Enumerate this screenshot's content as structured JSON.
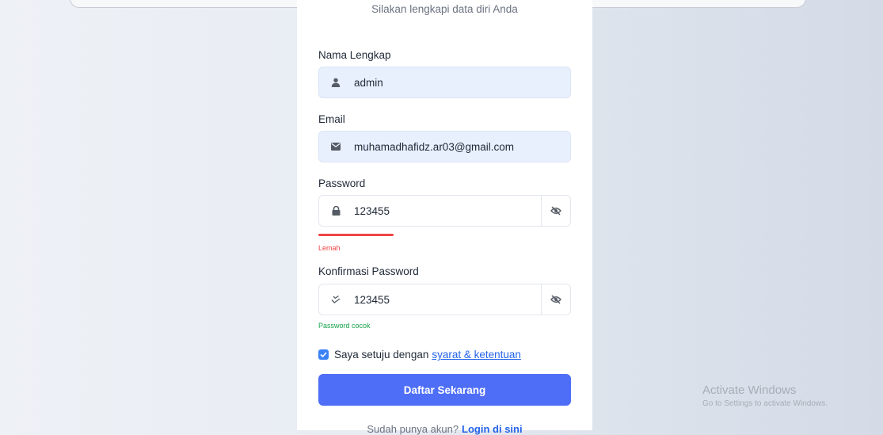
{
  "form": {
    "subtitle": "Silakan lengkapi data diri Anda",
    "name_label": "Nama Lengkap",
    "name_value": "admin",
    "email_label": "Email",
    "email_value": "muhamadhafidz.ar03@gmail.com",
    "password_label": "Password",
    "password_value": "123455",
    "strength_text": "Lemah",
    "strength_color": "#ef4444",
    "confirm_label": "Konfirmasi Password",
    "confirm_value": "123455",
    "match_text": "Password cocok",
    "match_color": "#16a34a",
    "agree_text": "Saya setuju dengan",
    "agree_link": "syarat & ketentuan",
    "agree_checked": true,
    "submit_label": "Daftar Sekarang",
    "footer_text": "Sudah punya akun?",
    "footer_link": "Login di sini"
  },
  "icons": {
    "name": "user-icon",
    "email": "envelope-icon",
    "password": "lock-icon",
    "confirm": "check-double-icon",
    "toggle": "eye-slash-icon",
    "checkbox": "checkmark-icon"
  },
  "colors": {
    "accent": "#4f6ef7",
    "link": "#2563eb",
    "filled_input_bg": "#e8f0fe"
  },
  "watermark": {
    "title": "Activate Windows",
    "subtitle": "Go to Settings to activate Windows."
  }
}
